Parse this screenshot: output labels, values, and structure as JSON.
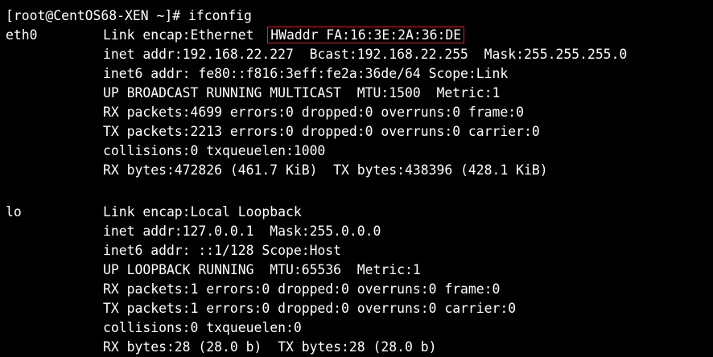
{
  "terminal": {
    "prompt_line": "[root@CentOS68-XEN ~]# ifconfig",
    "highlight_color": "#e02020",
    "interfaces": [
      {
        "name": "eth0",
        "link_encap_prefix": "Link encap:Ethernet  ",
        "hwaddr": "HWaddr FA:16:3E:2A:36:DE",
        "lines": [
          "inet addr:192.168.22.227  Bcast:192.168.22.255  Mask:255.255.255.0",
          "inet6 addr: fe80::f816:3eff:fe2a:36de/64 Scope:Link",
          "UP BROADCAST RUNNING MULTICAST  MTU:1500  Metric:1",
          "RX packets:4699 errors:0 dropped:0 overruns:0 frame:0",
          "TX packets:2213 errors:0 dropped:0 overruns:0 carrier:0",
          "collisions:0 txqueuelen:1000",
          "RX bytes:472826 (461.7 KiB)  TX bytes:438396 (428.1 KiB)"
        ]
      },
      {
        "name": "lo",
        "link_encap": "Link encap:Local Loopback",
        "lines": [
          "inet addr:127.0.0.1  Mask:255.0.0.0",
          "inet6 addr: ::1/128 Scope:Host",
          "UP LOOPBACK RUNNING  MTU:65536  Metric:1",
          "RX packets:1 errors:0 dropped:0 overruns:0 frame:0",
          "TX packets:1 errors:0 dropped:0 overruns:0 carrier:0",
          "collisions:0 txqueuelen:0",
          "RX bytes:28 (28.0 b)  TX bytes:28 (28.0 b)"
        ]
      }
    ]
  }
}
